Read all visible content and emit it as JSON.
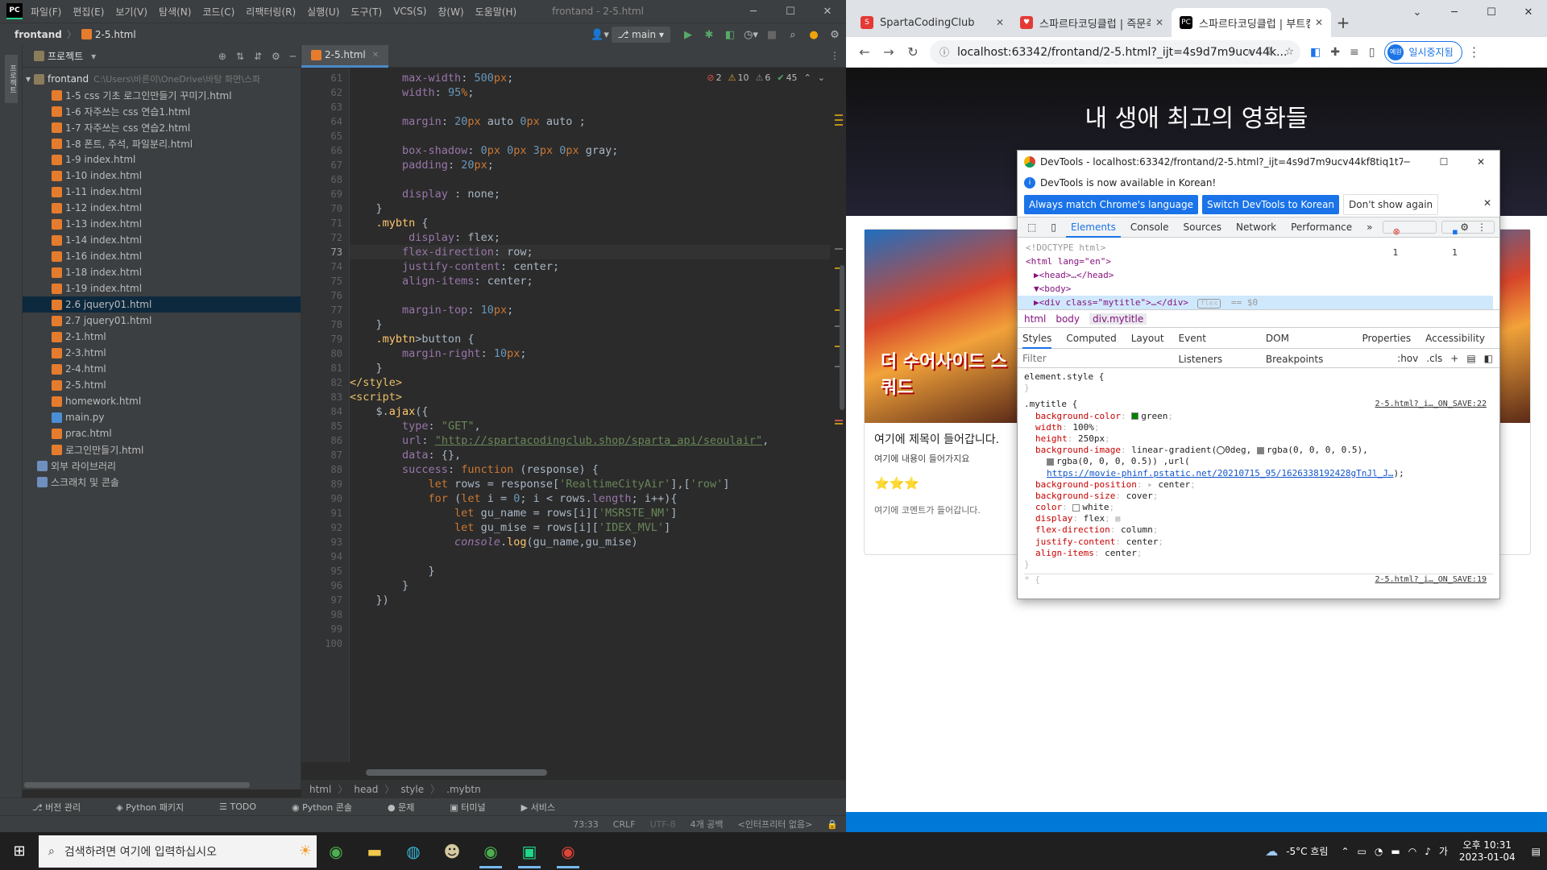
{
  "ide": {
    "logo": "PC",
    "menu": [
      "파일(F)",
      "편집(E)",
      "보기(V)",
      "탐색(N)",
      "코드(C)",
      "리팩터링(R)",
      "실행(U)",
      "도구(T)",
      "VCS(S)",
      "창(W)",
      "도움말(H)"
    ],
    "window_title": "frontand - 2-5.html",
    "breadcrumb": [
      "frontand",
      "2-5.html"
    ],
    "branch": "main",
    "project_label": "프로젝트",
    "root_name": "frontand",
    "root_path": "C:\\Users\\바른이\\OneDrive\\바탕 화면\\스파",
    "files": [
      "1-5 css 기초 로그인만들기 꾸미기.html",
      "1-6 자주쓰는 css 연습1.html",
      "1-7 자주쓰는 css 연습2.html",
      "1-8 폰트, 주석, 파일분리.html",
      "1-9 index.html",
      "1-10 index.html",
      "1-11 index.html",
      "1-12 index.html",
      "1-13 index.html",
      "1-14 index.html",
      "1-16 index.html",
      "1-18 index.html",
      "1-19 index.html",
      "2.6 jquery01.html",
      "2.7 jquery01.html",
      "2-1.html",
      "2-3.html",
      "2-4.html",
      "2-5.html",
      "homework.html",
      "main.py",
      "prac.html",
      "로그인만들기.html"
    ],
    "selected_file": "2.6 jquery01.html",
    "external_libs": "외부 라이브러리",
    "scratches": "스크래치 및 콘솔",
    "editor_tab": "2-5.html",
    "inspections": {
      "errors": "2",
      "warnings": "10",
      "weak": "6",
      "ok": "45"
    },
    "current_line": 73,
    "line_numbers": [
      61,
      62,
      63,
      64,
      65,
      66,
      67,
      68,
      69,
      70,
      71,
      72,
      73,
      74,
      75,
      76,
      77,
      78,
      79,
      80,
      81,
      82,
      83,
      84,
      85,
      86,
      87,
      88,
      89,
      90,
      91,
      92,
      93,
      94,
      95,
      96,
      97,
      98,
      99,
      100
    ],
    "bottom_breadcrumb": [
      "html",
      "head",
      "style",
      ".mybtn"
    ],
    "tool_windows": [
      "버전 관리",
      "Python 패키지",
      "TODO",
      "Python 콘솔",
      "문제",
      "터미널",
      "서비스"
    ],
    "status": {
      "position": "73:33",
      "line_sep": "CRLF",
      "encoding": "UTF-8",
      "indent": "4개 공백",
      "interpreter": "<인터프리터 없음>"
    }
  },
  "browser": {
    "tabs": [
      {
        "title": "SpartaCodingClub",
        "color": "#e53935"
      },
      {
        "title": "스파르타코딩클럽 | 즉문즉답",
        "color": "#e53935"
      },
      {
        "title": "스파르타코딩클럽 | 부트캠프",
        "color": "#000000"
      }
    ],
    "url": "localhost:63342/frontand/2-5.html?_ijt=4s9d7m9ucv44k...",
    "profile_label": "일시중지됨",
    "profile_avatar": "예원",
    "page": {
      "heading": "내 생애 최고의 영화들",
      "card_title": "여기에 제목이 들어갑니다.",
      "card_text": "여기에 내용이 들어가지요",
      "stars": "⭐⭐⭐",
      "card_comment": "여기에 코멘트가 들어갑니다.",
      "poster_text": "더 수어사이드 스쿼드"
    }
  },
  "devtools": {
    "title": "DevTools - localhost:63342/frontand/2-5.html?_ijt=4s9d7m9ucv44kf8tiq1t7so1...",
    "info": "DevTools is now available in Korean!",
    "buttons": [
      "Always match Chrome's language",
      "Switch DevTools to Korean",
      "Don't show again"
    ],
    "tabs": [
      "Elements",
      "Console",
      "Sources",
      "Network",
      "Performance"
    ],
    "badge_errors": "1",
    "badge_msgs": "1",
    "dom": [
      "<!DOCTYPE html>",
      "<html lang=\"en\">",
      "▶<head>…</head>",
      "▼<body>"
    ],
    "dom_selected": "▶<div class=\"mytitle\">…</div>",
    "dom_flex": "flex",
    "dom_eq": "== $0",
    "crumbs": [
      "html",
      "body",
      "div.mytitle"
    ],
    "subtabs": [
      "Styles",
      "Computed",
      "Layout",
      "Event Listeners",
      "DOM Breakpoints",
      "Properties",
      "Accessibility"
    ],
    "filter_placeholder": "Filter",
    "filter_tools": [
      ":hov",
      ".cls",
      "+"
    ],
    "element_style": "element.style {",
    "rule_selector": ".mytitle {",
    "rule_source": "2-5.html?_i…_ON_SAVE:22",
    "rule_source2": "2-5.html?_i…_ON_SAVE:19",
    "url_link": "https://movie-phinf.pstatic.net/20210715_95/1626338192428gTnJl_J…"
  },
  "taskbar": {
    "search_placeholder": "검색하려면 여기에 입력하십시오",
    "weather": "-5°C  흐림",
    "time": "오후 10:31",
    "date": "2023-01-04"
  }
}
